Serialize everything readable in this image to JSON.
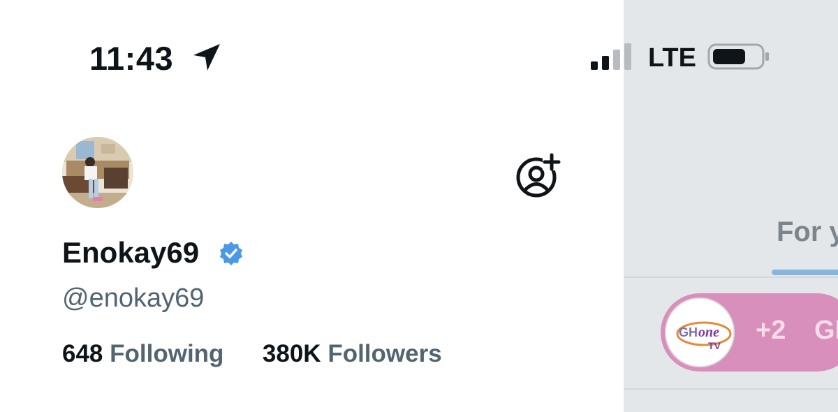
{
  "status_bar": {
    "time": "11:43",
    "network": "LTE",
    "location_icon": "location-arrow-icon",
    "signal_icon": "cellular-signal-icon",
    "battery_icon": "battery-icon"
  },
  "drawer": {
    "profile": {
      "display_name": "Enokay69",
      "handle": "@enokay69",
      "verified": true,
      "verified_color": "#4a99e9",
      "following_count": "648",
      "following_label": "Following",
      "followers_count": "380K",
      "followers_label": "Followers"
    },
    "add_account_icon": "add-account-icon"
  },
  "background_feed": {
    "tab_label": "For y",
    "spaces": {
      "extra_listeners": "+2",
      "title_fragment": "GI",
      "host_logo_text_left": "GH",
      "host_logo_text_right": "one",
      "host_logo_text_bottom": "TV",
      "pill_color": "#d88fbb"
    }
  },
  "colors": {
    "primary_text": "#0f1419",
    "secondary_text": "#536471",
    "accent": "#1d9bf0"
  }
}
